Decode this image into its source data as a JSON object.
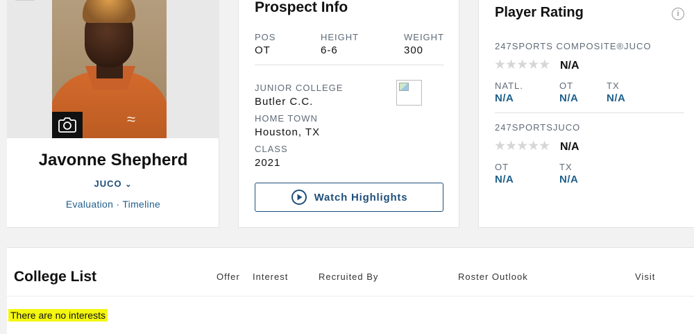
{
  "player": {
    "name": "Javonne Shepherd",
    "level": "JUCO",
    "links": [
      "Evaluation",
      "Timeline"
    ]
  },
  "prospect": {
    "title": "Prospect Info",
    "pos_label": "POS",
    "pos": "OT",
    "height_label": "HEIGHT",
    "height": "6-6",
    "weight_label": "WEIGHT",
    "weight": "300",
    "college_label": "JUNIOR COLLEGE",
    "college": "Butler C.C.",
    "hometown_label": "HOME TOWN",
    "hometown": "Houston, TX",
    "class_label": "CLASS",
    "class": "2021",
    "watch_label": "Watch Highlights"
  },
  "rating": {
    "title": "Player Rating",
    "info": "i",
    "composite": {
      "heading": "247SPORTS COMPOSITE®JUCO",
      "value": "N/A",
      "stars_filled": 0,
      "ranks": [
        {
          "label": "NATL.",
          "value": "N/A"
        },
        {
          "label": "OT",
          "value": "N/A"
        },
        {
          "label": "TX",
          "value": "N/A"
        }
      ]
    },
    "sports247": {
      "heading": "247SPORTSJUCO",
      "value": "N/A",
      "stars_filled": 0,
      "ranks": [
        {
          "label": "OT",
          "value": "N/A"
        },
        {
          "label": "TX",
          "value": "N/A"
        }
      ]
    }
  },
  "college_list": {
    "title": "College List",
    "columns": [
      "Offer",
      "Interest",
      "Recruited By",
      "Roster Outlook",
      "Visit"
    ],
    "empty_message": "There are no interests"
  },
  "colors": {
    "link_blue": "#1f5f8b",
    "highlight": "#f4f70f"
  },
  "icons": {
    "camera": "camera-icon",
    "play": "play-circle-icon",
    "star": "star-icon",
    "chevron": "chevron-down-icon"
  }
}
